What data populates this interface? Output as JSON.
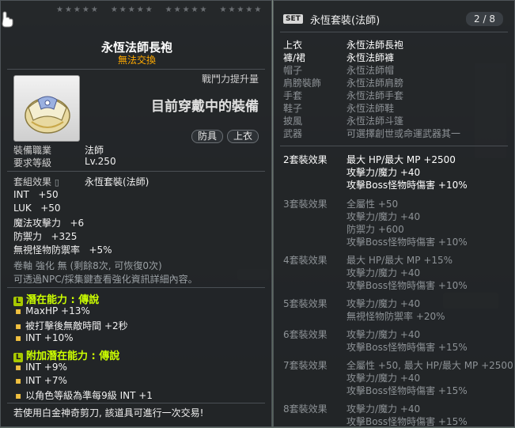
{
  "item": {
    "name": "永恆法師長袍",
    "trade_status": "無法交換",
    "combat_power_label": "戰鬥力提升量",
    "current_equipped": "目前穿戴中的裝備",
    "tags": [
      "防具",
      "上衣"
    ],
    "job_label": "裝備職業",
    "job_value": "法師",
    "req_level_label": "要求等級",
    "req_level_value": "Lv.250",
    "set_effect_label": "套組效果",
    "set_effect_value": "永恆套裝(法師)",
    "stats": [
      {
        "name": "INT",
        "value": "+50"
      },
      {
        "name": "LUK",
        "value": "+50"
      },
      {
        "name": "魔法攻擊力",
        "value": "+6"
      },
      {
        "name": "防禦力",
        "value": "+325"
      },
      {
        "name": "無視怪物防禦率",
        "value": "+5%"
      }
    ],
    "scroll_line": "卷軸 強化 無 (剩餘8次, 可恢復0次)",
    "npc_line": "可透過NPC/採集鍵查看強化資訊詳細內容。",
    "potential_header": "潛在能力 : 傳說",
    "potential_lines": [
      "MaxHP +13%",
      "被打擊後無敵時間 +2秒",
      "INT +10%"
    ],
    "additional_header": "附加潛在能力 : 傳說",
    "additional_lines": [
      "INT +9%",
      "INT +7%",
      "以角色等級為準每9級 INT +1"
    ],
    "scissors_note": "若使用白金神奇剪刀, 該道具可進行一次交易!"
  },
  "set": {
    "badge": "SET",
    "title": "永恆套裝(法師)",
    "count": "2 / 8",
    "pieces": [
      {
        "slot": "上衣",
        "name": "永恆法師長袍",
        "equipped": true
      },
      {
        "slot": "褲/裙",
        "name": "永恆法師褲",
        "equipped": true
      },
      {
        "slot": "帽子",
        "name": "永恆法師帽",
        "equipped": false
      },
      {
        "slot": "肩膀裝飾",
        "name": "永恆法師肩膀",
        "equipped": false
      },
      {
        "slot": "手套",
        "name": "永恆法師手套",
        "equipped": false
      },
      {
        "slot": "鞋子",
        "name": "永恆法師鞋",
        "equipped": false
      },
      {
        "slot": "披風",
        "name": "永恆法師斗篷",
        "equipped": false
      },
      {
        "slot": "武器",
        "name": "可選擇創世或命運武器其一",
        "equipped": false
      }
    ],
    "effects": [
      {
        "label": "2套裝效果",
        "active": true,
        "lines": [
          "最大 HP/最大 MP +2500",
          "攻擊力/魔力 +40",
          "攻擊Boss怪物時傷害 +10%"
        ]
      },
      {
        "label": "3套裝效果",
        "active": false,
        "lines": [
          "全屬性 +50",
          "攻擊力/魔力 +40",
          "防禦力 +600",
          "攻擊Boss怪物時傷害 +10%"
        ]
      },
      {
        "label": "4套裝效果",
        "active": false,
        "lines": [
          "最大 HP/最大 MP +15%",
          "攻擊力/魔力 +40",
          "攻擊Boss怪物時傷害 +10%"
        ]
      },
      {
        "label": "5套裝效果",
        "active": false,
        "lines": [
          "攻擊力/魔力 +40",
          "無視怪物防禦率 +20%"
        ]
      },
      {
        "label": "6套裝效果",
        "active": false,
        "lines": [
          "攻擊力/魔力 +40",
          "攻擊Boss怪物時傷害 +15%"
        ]
      },
      {
        "label": "7套裝效果",
        "active": false,
        "lines": [
          "全屬性 +50, 最大 HP/最大 MP +2500",
          "攻擊力/魔力 +40",
          "攻擊Boss怪物時傷害 +15%"
        ]
      },
      {
        "label": "8套裝效果",
        "active": false,
        "lines": [
          "攻擊力/魔力 +40",
          "攻擊Boss怪物時傷害 +15%"
        ]
      }
    ]
  }
}
